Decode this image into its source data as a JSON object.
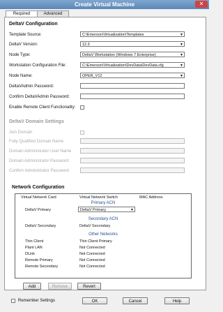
{
  "window": {
    "title": "Create Virtual Machine"
  },
  "tabs": [
    {
      "label": "Required"
    },
    {
      "label": "Advanced"
    }
  ],
  "deltav": {
    "heading": "DeltaV Configuration",
    "fields": {
      "template_source": {
        "label": "Template Source:",
        "value": "C:\\Emerson\\Virtualization\\Templates"
      },
      "deltav_version": {
        "label": "DeltaV Version:",
        "value": "12.3"
      },
      "node_type": {
        "label": "Node Type:",
        "value": "DeltaV Workstation (Windows 7 Enterprise)"
      },
      "workstation_config": {
        "label": "Workstation Configuration File:",
        "value": "C:\\Emerson\\Virtualization\\DevData\\DevData.cfg"
      },
      "node_name": {
        "label": "Node Name:",
        "value": "OPER_V12"
      },
      "admin_password": {
        "label": "DeltaVAdmin Password:",
        "value": ""
      },
      "confirm_admin_password": {
        "label": "Confirm DeltaVAdmin Password:",
        "value": ""
      },
      "remote_client": {
        "label": "Enable Remote Client Functionality:"
      }
    }
  },
  "domain": {
    "heading": "DeltaV Domain Settings",
    "join_domain": "Join Domain",
    "fqdn": "Fully Qualified Domain Name",
    "admin_user": "Domain Administrator User Name",
    "admin_password": "Domain Administrator Password",
    "confirm_admin_password": "Confirm Administrator Password"
  },
  "network": {
    "heading": "Network Configuration",
    "columns": [
      "Virtual Network Card",
      "Virtual Network Switch",
      "MAC Address"
    ],
    "groups": {
      "primary": "Primary ACN",
      "secondary": "Secondary ACN",
      "other": "Other Networks"
    },
    "primary_row": {
      "card": "DeltaV Primary",
      "switch": "DeltaV Primary"
    },
    "secondary_row": {
      "card": "DeltaV Secondary",
      "switch": "DeltaV Secondary"
    },
    "other_rows": [
      {
        "card": "Thin Client",
        "switch": "Thin Client Primary"
      },
      {
        "card": "Plant LAN",
        "switch": "Not Connected"
      },
      {
        "card": "DLink",
        "switch": "Not Connected"
      },
      {
        "card": "Remote Primary",
        "switch": "Not Connected"
      },
      {
        "card": "Remote Secondary",
        "switch": "Not Connected"
      }
    ],
    "buttons": {
      "add": "Add",
      "remove": "Remove",
      "revert": "Revert"
    }
  },
  "footer": {
    "remember": "Remember Settings",
    "ok": "OK",
    "cancel": "Cancel",
    "help": "Help"
  }
}
